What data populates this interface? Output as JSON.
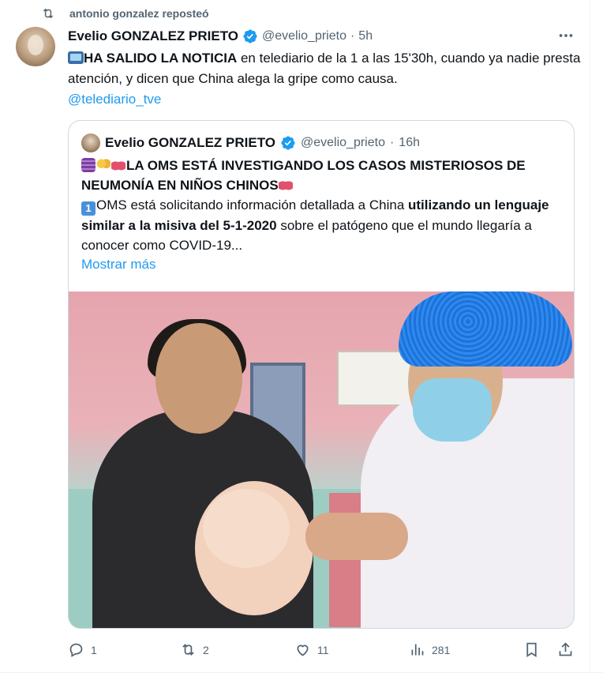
{
  "repost": {
    "label": "antonio gonzalez reposteó"
  },
  "tweet": {
    "name": "Evelio GONZALEZ PRIETO",
    "handle": "@evelio_prieto",
    "time": "5h",
    "text_bold": "HA SALIDO LA NOTICIA",
    "text_rest": " en telediario de la 1 a las 15'30h, cuando ya nadie presta atención, y dicen que China alega la gripe como causa.",
    "mention": "@telediario_tve"
  },
  "quote": {
    "name": "Evelio GONZALEZ PRIETO",
    "handle": "@evelio_prieto",
    "time": "16h",
    "headline_1": "LA OMS ESTÁ INVESTIGANDO LOS CASOS MISTERIOSOS DE NEUMONÍA EN NIÑOS CHINOS",
    "body_1": "OMS está solicitando información detallada a China ",
    "body_bold": "utilizando un lenguaje similar a la misiva del 5-1-2020",
    "body_2": " sobre el patógeno que el mundo llegaría a conocer como COVID-19...",
    "show_more": "Mostrar más",
    "number_emoji": "1"
  },
  "actions": {
    "replies": "1",
    "reposts": "2",
    "likes": "11",
    "views": "281"
  },
  "colors": {
    "link": "#1d9bf0",
    "muted": "#536471",
    "verified": "#1d9bf0"
  },
  "icons": [
    "repost-icon",
    "verified-badge-icon",
    "more-icon",
    "reply-icon",
    "like-icon",
    "views-icon",
    "bookmark-icon",
    "share-icon"
  ]
}
